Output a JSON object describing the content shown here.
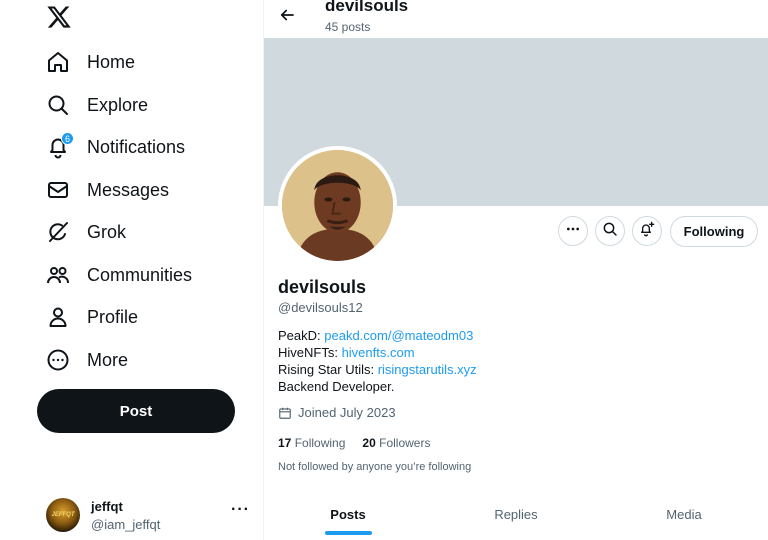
{
  "nav": {
    "items": [
      {
        "label": "Home",
        "icon": "home-icon"
      },
      {
        "label": "Explore",
        "icon": "search-icon"
      },
      {
        "label": "Notifications",
        "icon": "bell-icon",
        "badge": "6"
      },
      {
        "label": "Messages",
        "icon": "envelope-icon"
      },
      {
        "label": "Grok",
        "icon": "grok-icon"
      },
      {
        "label": "Communities",
        "icon": "communities-icon"
      },
      {
        "label": "Profile",
        "icon": "person-icon"
      },
      {
        "label": "More",
        "icon": "more-circle-icon"
      }
    ],
    "post_label": "Post"
  },
  "account": {
    "name": "jeffqt",
    "handle": "@iam_jeffqt",
    "avatar_text": "JEFFQT",
    "more": "···"
  },
  "header": {
    "title": "devilsouls",
    "posts_count": "45 posts"
  },
  "profile": {
    "name": "devilsouls",
    "handle": "@devilsouls12",
    "following_button": "Following",
    "bio": [
      {
        "prefix": "PeakD: ",
        "link": "peakd.com/@mateodm03"
      },
      {
        "prefix": "HiveNFTs: ",
        "link": "hivenfts.com"
      },
      {
        "prefix": "Rising Star Utils: ",
        "link": "risingstarutils.xyz"
      },
      {
        "prefix": "Backend Developer.",
        "link": ""
      }
    ],
    "joined": "Joined July 2023",
    "following_count": "17",
    "following_label": "Following",
    "followers_count": "20",
    "followers_label": "Followers",
    "not_followed": "Not followed by anyone you’re following"
  },
  "tabs": [
    {
      "label": "Posts",
      "active": true
    },
    {
      "label": "Replies",
      "active": false
    },
    {
      "label": "Media",
      "active": false
    }
  ],
  "colors": {
    "accent": "#1d9bf0",
    "banner": "#cfd9de",
    "text": "#0f1419",
    "secondary": "#536471"
  }
}
